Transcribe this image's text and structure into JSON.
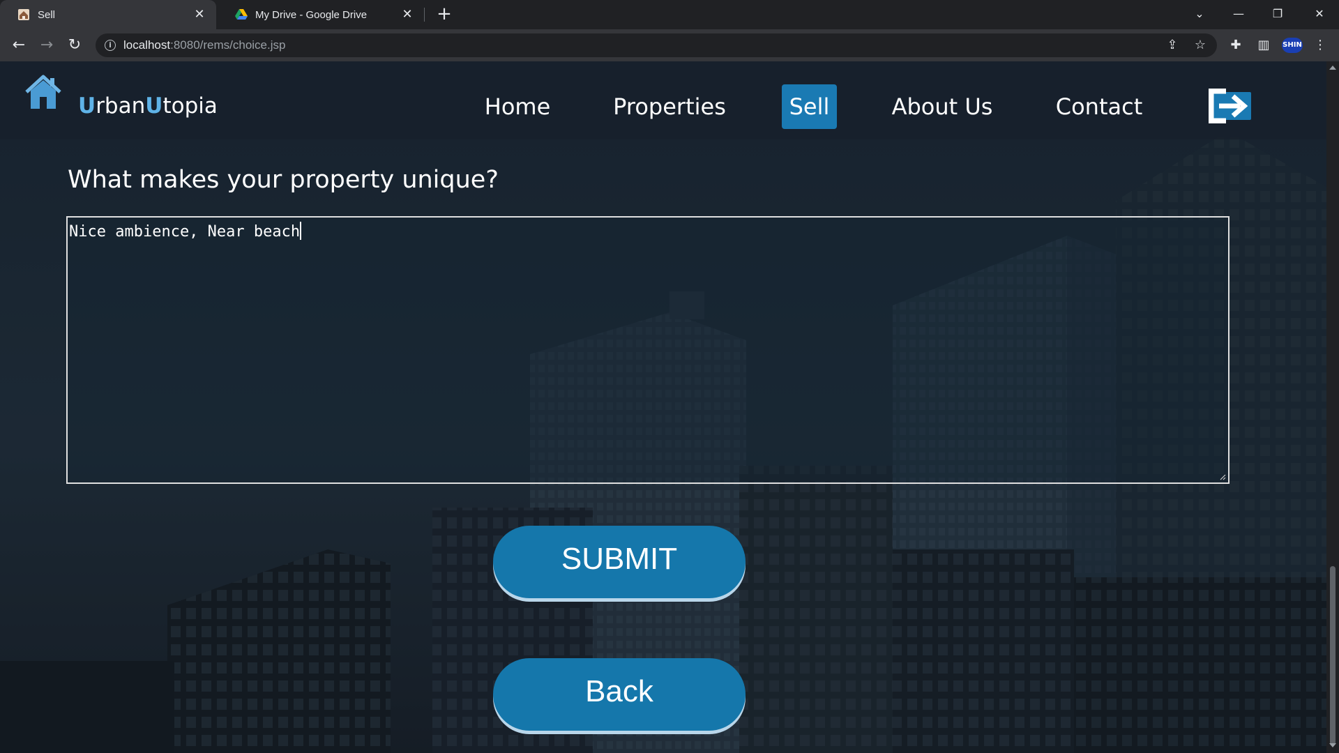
{
  "browser": {
    "tabs": [
      {
        "title": "Sell",
        "active": true,
        "icon": "house-favicon"
      },
      {
        "title": "My Drive - Google Drive",
        "active": false,
        "icon": "google-drive-favicon"
      }
    ],
    "url_host": "localhost",
    "url_path": ":8080/rems/choice.jsp",
    "profile_label": "SHIN"
  },
  "site": {
    "brand_u1": "U",
    "brand_rest1": "rban",
    "brand_u2": "U",
    "brand_rest2": "topia",
    "nav": [
      {
        "label": "Home"
      },
      {
        "label": "Properties"
      },
      {
        "label": "Sell",
        "active": true
      },
      {
        "label": "About Us"
      },
      {
        "label": "Contact"
      }
    ],
    "accent_color": "#1577ab",
    "logout_icon": "logout-arrow-icon"
  },
  "form": {
    "question": "What makes your property unique?",
    "answer": "Nice ambience, Near beach"
  },
  "buttons": {
    "submit": "SUBMIT",
    "back": "Back"
  }
}
